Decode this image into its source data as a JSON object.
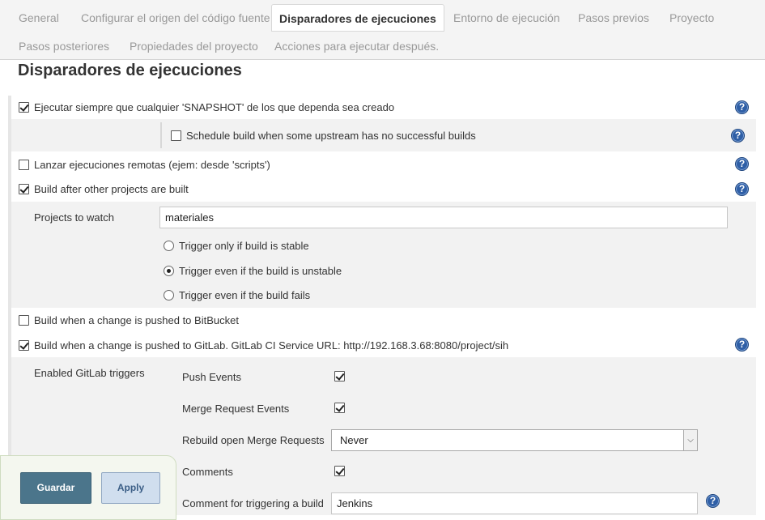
{
  "tabs": [
    {
      "label": "General"
    },
    {
      "label": "Configurar el origen del código fuente"
    },
    {
      "label": "Disparadores de ejecuciones",
      "active": true
    },
    {
      "label": "Entorno de ejecución"
    },
    {
      "label": "Pasos previos"
    },
    {
      "label": "Proyecto"
    },
    {
      "label": "Pasos posteriores"
    },
    {
      "label": "Propiedades del proyecto"
    },
    {
      "label": "Acciones para ejecutar después."
    }
  ],
  "section": {
    "title": "Disparadores de ejecuciones"
  },
  "help_glyph": "?",
  "triggers": {
    "snapshot": {
      "label": "Ejecutar siempre que cualquier 'SNAPSHOT' de los que dependa sea creado",
      "checked": true
    },
    "upstream_no_success": {
      "label": "Schedule build when some upstream has no successful builds",
      "checked": false
    },
    "remote": {
      "label": "Lanzar ejecuciones remotas (ejem: desde 'scripts')",
      "checked": false
    },
    "after_other": {
      "label": "Build after other projects are built",
      "checked": true
    },
    "projects_to_watch": {
      "label": "Projects to watch",
      "value": "materiales"
    },
    "radios": [
      {
        "label": "Trigger only if build is stable",
        "selected": false
      },
      {
        "label": "Trigger even if the build is unstable",
        "selected": true
      },
      {
        "label": "Trigger even if the build fails",
        "selected": false
      }
    ],
    "bitbucket": {
      "label": "Build when a change is pushed to BitBucket",
      "checked": false
    },
    "gitlab": {
      "label": "Build when a change is pushed to GitLab. GitLab CI Service URL: http://192.168.3.68:8080/project/sih",
      "checked": true
    }
  },
  "gitlab_triggers": {
    "label": "Enabled GitLab triggers",
    "push_events": {
      "label": "Push Events",
      "checked": true
    },
    "merge_request_events": {
      "label": "Merge Request Events",
      "checked": true
    },
    "rebuild_mr": {
      "label": "Rebuild open Merge Requests",
      "value": "Never"
    },
    "comments": {
      "label": "Comments",
      "checked": true
    },
    "comment_phrase": {
      "label": "Comment for triggering a build",
      "value": "Jenkins"
    }
  },
  "buttons": {
    "save": "Guardar",
    "apply": "Apply"
  }
}
